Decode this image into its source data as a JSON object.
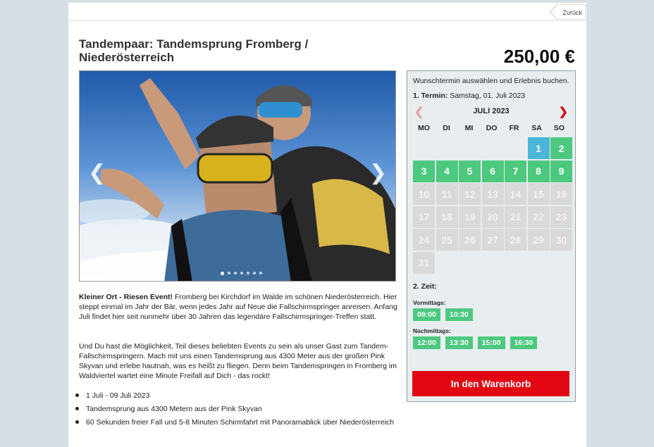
{
  "nav": {
    "back_label": "Zurück"
  },
  "product": {
    "title": "Tandempaar: Tandemsprung Fromberg / Niederösterreich",
    "price": "250,00 €"
  },
  "gallery": {
    "prev_icon": "chevron-left-icon",
    "next_icon": "chevron-right-icon",
    "dot_count": 7,
    "active_dot": 0
  },
  "description": {
    "lead_bold": "Kleiner Ort - Riesen Event!",
    "lead_text": " Fromberg bei Kirchdorf im Walde im schönen Niederösterreich. Hier steppt einmal im Jahr der Bär, wenn jedes Jahr auf Neue die Fallschirmspringer anreisen. Anfang Juli findet hier seit nunmehr über 30 Jahren das legendäre Fallschirmspringer-Treffen statt.",
    "paragraph2": "Und Du hast die Möglichkeit, Teil dieses beliebten Events zu sein als unser Gast zum Tandem-Fallschirmspringern. Mach mit uns einen Tandemsprung aus 4300 Meter aus der großen Pink Skyvan und erlebe hautnah, was es heißt zu fliegen. Denn beim Tandemspringen in Fromberg im Waldviertel wartet eine Minute Freifall auf Dich - das rockt!",
    "bullets": [
      "1 Juli - 09 Juli 2023",
      "Tandemsprung aus 4300 Metern aus der Pink Skyvan",
      "60 Sekunden freier Fall und 5-8 Minuten Schirmfahrt mit Panoramablick über Niederösterreich"
    ]
  },
  "booking": {
    "intro": "Wunschtermin auswählen und Erlebnis buchen.",
    "termin_label": "1. Termin:",
    "termin_value": "Samstag, 01. Juli 2023",
    "month": "JULI 2023",
    "weekdays": [
      "MO",
      "DI",
      "MI",
      "DO",
      "FR",
      "SA",
      "SO"
    ],
    "leading_blanks": 5,
    "days": [
      {
        "n": "1",
        "s": "sel"
      },
      {
        "n": "2",
        "s": "avail"
      },
      {
        "n": "3",
        "s": "avail"
      },
      {
        "n": "4",
        "s": "avail"
      },
      {
        "n": "5",
        "s": "avail"
      },
      {
        "n": "6",
        "s": "avail"
      },
      {
        "n": "7",
        "s": "avail"
      },
      {
        "n": "8",
        "s": "avail"
      },
      {
        "n": "9",
        "s": "avail"
      },
      {
        "n": "10",
        "s": "dis"
      },
      {
        "n": "11",
        "s": "dis"
      },
      {
        "n": "12",
        "s": "dis"
      },
      {
        "n": "13",
        "s": "dis"
      },
      {
        "n": "14",
        "s": "dis"
      },
      {
        "n": "15",
        "s": "dis"
      },
      {
        "n": "16",
        "s": "dis"
      },
      {
        "n": "17",
        "s": "dis"
      },
      {
        "n": "18",
        "s": "dis"
      },
      {
        "n": "19",
        "s": "dis"
      },
      {
        "n": "20",
        "s": "dis"
      },
      {
        "n": "21",
        "s": "dis"
      },
      {
        "n": "22",
        "s": "dis"
      },
      {
        "n": "23",
        "s": "dis"
      },
      {
        "n": "24",
        "s": "dis"
      },
      {
        "n": "25",
        "s": "dis"
      },
      {
        "n": "26",
        "s": "dis"
      },
      {
        "n": "27",
        "s": "dis"
      },
      {
        "n": "28",
        "s": "dis"
      },
      {
        "n": "29",
        "s": "dis"
      },
      {
        "n": "30",
        "s": "dis"
      },
      {
        "n": "31",
        "s": "dis"
      }
    ],
    "zeit_label": "2. Zeit:",
    "morning_label": "Vormittags:",
    "morning_slots": [
      "09:00",
      "10:30"
    ],
    "afternoon_label": "Nachmittags:",
    "afternoon_slots": [
      "12:00",
      "13:30",
      "15:00",
      "16:30"
    ],
    "cart_label": "In den Warenkorb"
  },
  "colors": {
    "available": "#4cc97f",
    "selected": "#4ab6d8",
    "disabled": "#d9d9d9",
    "cta": "#e30613"
  }
}
